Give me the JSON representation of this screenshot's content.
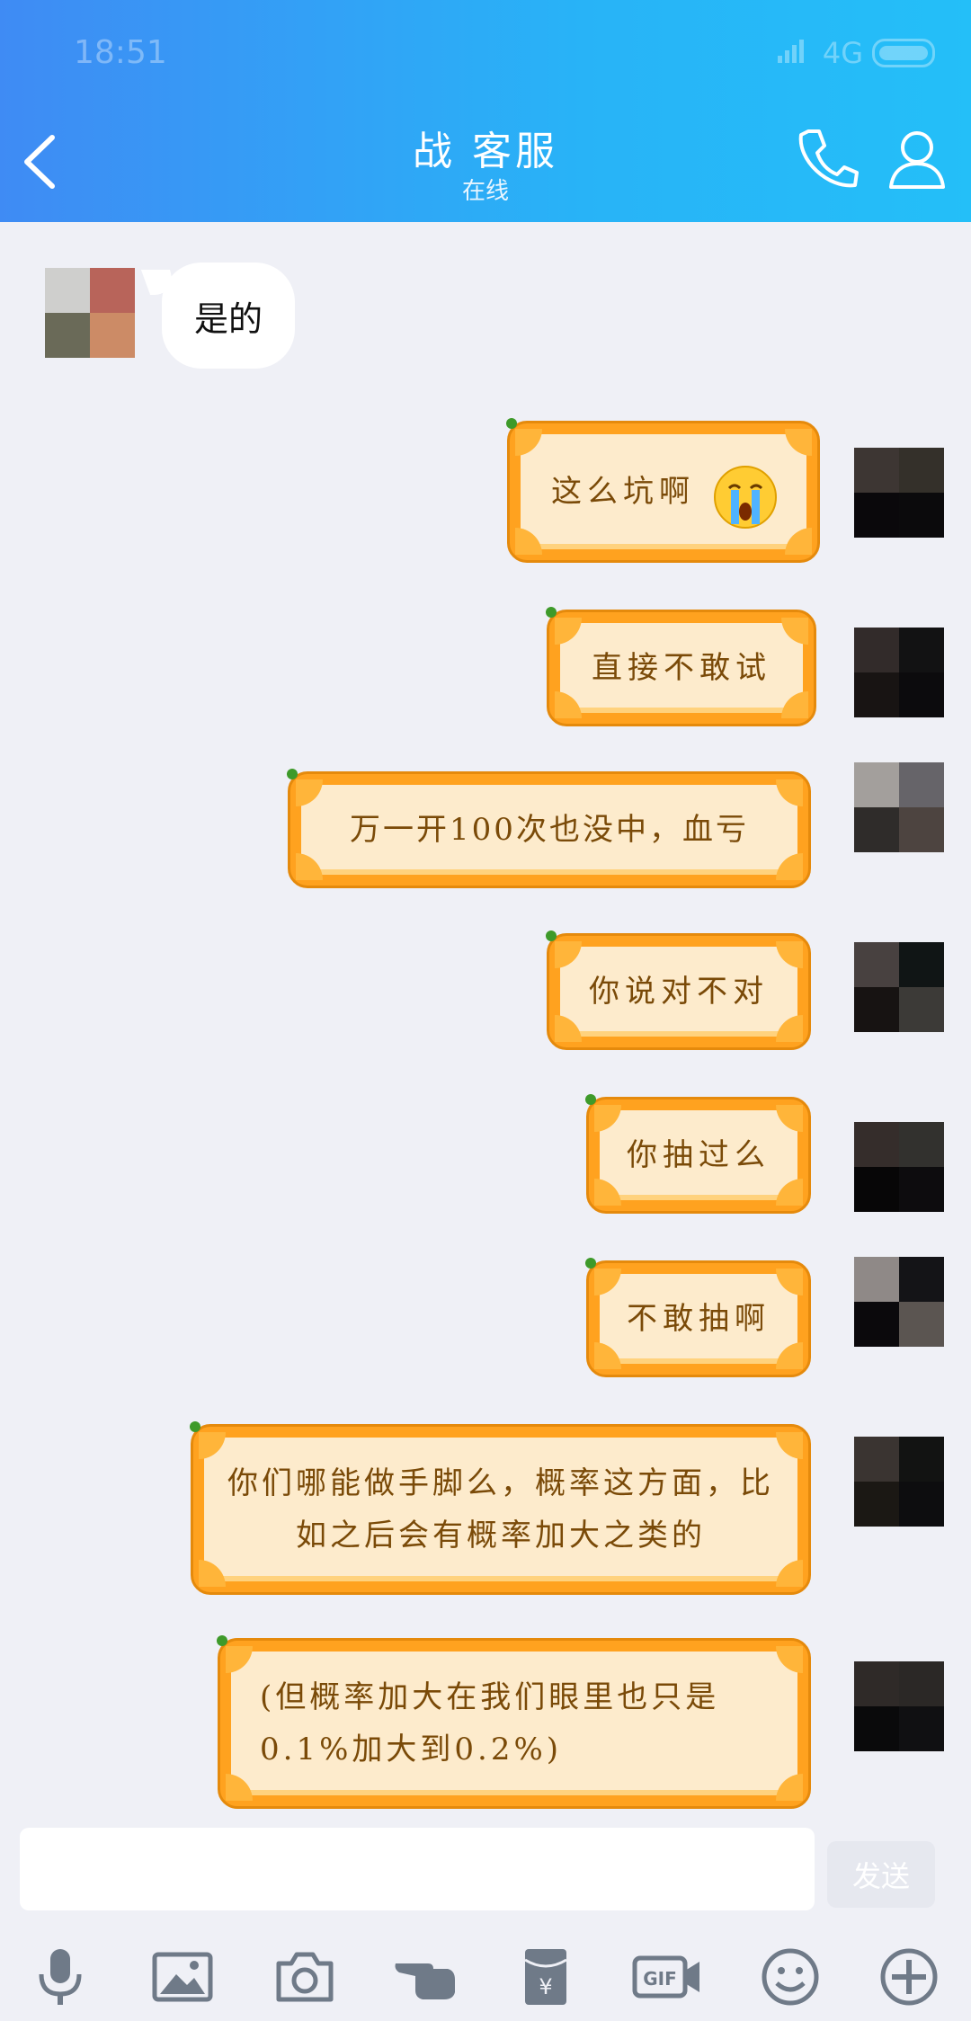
{
  "status_bar": {
    "time": "18:51",
    "network": "4G"
  },
  "header": {
    "title": "战 客服",
    "subtitle": "在线"
  },
  "messages": {
    "incoming_1": "是的",
    "out_1": "这么坑啊",
    "out_2": "直接不敢试",
    "out_3": "万一开100次也没中，血亏",
    "out_4": "你说对不对",
    "out_5": "你抽过么",
    "out_6": "不敢抽啊",
    "out_7": "你们哪能做手脚么，概率这方面，比如之后会有概率加大之类的",
    "out_8": "(但概率加大在我们眼里也只是0.1%加大到0.2%)"
  },
  "composer": {
    "send_label": "发送",
    "placeholder": ""
  },
  "toolbar_icons": [
    "microphone-icon",
    "image-icon",
    "camera-icon",
    "poke-icon",
    "red-packet-icon",
    "gif-icon",
    "emoji-icon",
    "plus-icon"
  ],
  "colors": {
    "header_start": "#3f8bf4",
    "header_end": "#24bff8",
    "bubble_orange": "#ffa21f",
    "bubble_cream": "#fdebcc"
  }
}
